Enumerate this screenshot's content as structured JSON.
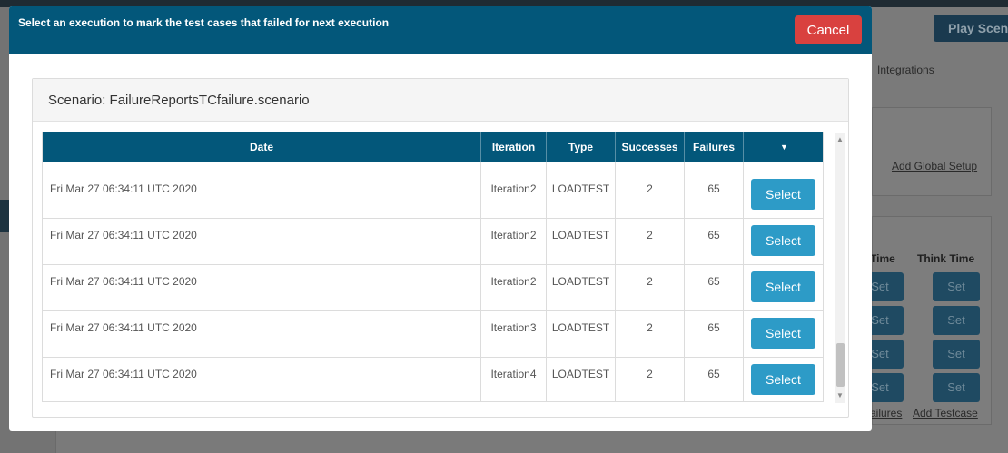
{
  "background": {
    "play_button": "Play Scen",
    "integrations_tab": "Integrations",
    "add_global_setup": "Add Global Setup",
    "col_time": "Time",
    "col_think_time": "Think Time",
    "set_label": "Set",
    "failures_link": "ailures",
    "add_testcase_link": "Add Testcase"
  },
  "modal": {
    "title": "Select an execution to mark the test cases that failed for next execution",
    "cancel_label": "Cancel",
    "scenario_label": "Scenario: FailureReportsTCfailure.scenario",
    "columns": [
      "Date",
      "Iteration",
      "Type",
      "Successes",
      "Failures"
    ],
    "select_column_icon": "caret-down-icon",
    "select_label": "Select",
    "rows": [
      {
        "date": "Fri Mar 27 06:34:11 UTC 2020",
        "iteration": "Iteration2",
        "type": "LOADTEST",
        "successes": "2",
        "failures": "65"
      },
      {
        "date": "Fri Mar 27 06:34:11 UTC 2020",
        "iteration": "Iteration2",
        "type": "LOADTEST",
        "successes": "2",
        "failures": "65"
      },
      {
        "date": "Fri Mar 27 06:34:11 UTC 2020",
        "iteration": "Iteration2",
        "type": "LOADTEST",
        "successes": "2",
        "failures": "65"
      },
      {
        "date": "Fri Mar 27 06:34:11 UTC 2020",
        "iteration": "Iteration3",
        "type": "LOADTEST",
        "successes": "2",
        "failures": "65"
      },
      {
        "date": "Fri Mar 27 06:34:11 UTC 2020",
        "iteration": "Iteration4",
        "type": "LOADTEST",
        "successes": "2",
        "failures": "65"
      }
    ]
  },
  "colors": {
    "header_bg": "#03577a",
    "cancel_bg": "#d9413f",
    "select_bg": "#2d9bc7"
  }
}
